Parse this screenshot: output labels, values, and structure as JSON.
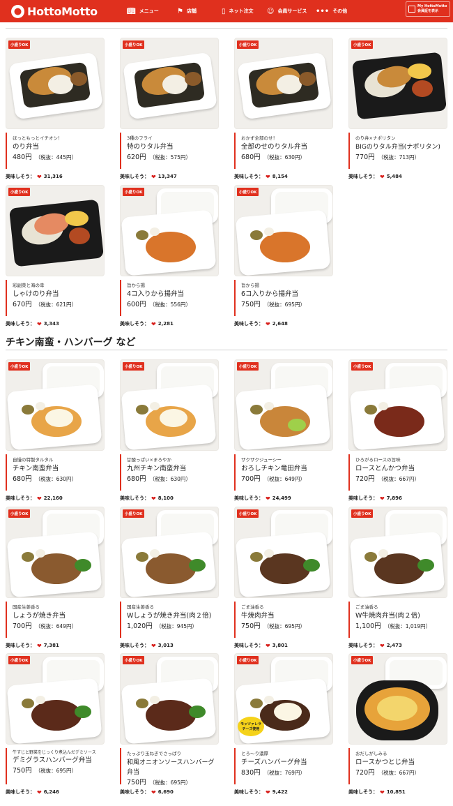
{
  "header": {
    "logo_text": "HottoMotto",
    "nav": [
      {
        "label": "メニュー",
        "icon": "book-icon"
      },
      {
        "label": "店舗",
        "icon": "map-pin-icon"
      },
      {
        "label": "ネット注文",
        "icon": "phone-icon"
      },
      {
        "label": "会員サービス",
        "icon": "people-icon"
      },
      {
        "label": "その他",
        "icon": "dots-icon"
      }
    ],
    "member_line1": "My HottoMotto",
    "member_line2": "会員証を表示"
  },
  "badge_label": "小盛りOK",
  "likes_label": "美味しそう：",
  "section_title": "チキン南蛮・ハンバーグ など",
  "colors": {
    "brand": "#e0301e",
    "heart": "#d8201c"
  },
  "items": [
    {
      "sub": "ほっともっとイチオシ！",
      "name": "のり弁当",
      "price": "480円",
      "tax": "（税抜：445円）",
      "likes": "31,316",
      "style": "nori"
    },
    {
      "sub": "3種のフライ",
      "name": "特のりタル弁当",
      "price": "620円",
      "tax": "（税抜：575円）",
      "likes": "13,347",
      "style": "nori"
    },
    {
      "sub": "おかず全部のせ！",
      "name": "全部のせのりタル弁当",
      "price": "680円",
      "tax": "（税抜：630円）",
      "likes": "8,154",
      "style": "nori"
    },
    {
      "sub": "のり弁×ナポリタン",
      "name": "BIGのりタル弁当(ナポリタン)",
      "price": "770円",
      "tax": "（税抜：713円）",
      "likes": "5,484",
      "style": "dark"
    },
    {
      "sub": "彩副菜と海の幸",
      "name": "しゃけのり弁当",
      "price": "670円",
      "tax": "（税抜：621円）",
      "likes": "3,343",
      "style": "dark"
    },
    {
      "sub": "旨から揚",
      "name": "4コ入りから揚弁当",
      "price": "600円",
      "tax": "（税抜：556円）",
      "likes": "2,281",
      "style": "karaage"
    },
    {
      "sub": "旨から揚",
      "name": "6コ入りから揚弁当",
      "price": "750円",
      "tax": "（税抜：695円）",
      "likes": "2,648",
      "style": "karaage"
    },
    {
      "sub": "自慢の特製タルタル",
      "name": "チキン南蛮弁当",
      "price": "680円",
      "tax": "（税抜：630円）",
      "likes": "22,160",
      "style": "nanban"
    },
    {
      "sub": "甘酸っぱい×まろやか",
      "name": "九州チキン南蛮弁当",
      "price": "680円",
      "tax": "（税抜：630円）",
      "likes": "8,100",
      "style": "nanban"
    },
    {
      "sub": "ザクザクジューシー",
      "name": "おろしチキン竜田弁当",
      "price": "700円",
      "tax": "（税抜：649円）",
      "likes": "24,499",
      "style": "tatsuta"
    },
    {
      "sub": "ひろがるロースの旨味",
      "name": "ロースとんかつ弁当",
      "price": "720円",
      "tax": "（税抜：667円）",
      "likes": "7,896",
      "style": "tonkatsu"
    },
    {
      "sub": "国産生姜香る",
      "name": "しょうが焼き弁当",
      "price": "700円",
      "tax": "（税抜：649円）",
      "likes": "7,381",
      "style": "shoga"
    },
    {
      "sub": "国産生姜香る",
      "name": "Wしょうが焼き弁当(肉２倍)",
      "price": "1,020円",
      "tax": "（税抜：945円）",
      "likes": "3,013",
      "style": "shoga"
    },
    {
      "sub": "ごま油香る",
      "name": "牛焼肉弁当",
      "price": "750円",
      "tax": "（税抜：695円）",
      "likes": "3,801",
      "style": "yakiniku"
    },
    {
      "sub": "ごま油香る",
      "name": "W牛焼肉弁当(肉２倍)",
      "price": "1,100円",
      "tax": "（税抜：1,019円）",
      "likes": "2,473",
      "style": "yakiniku"
    },
    {
      "sub": "牛すじと野菜をじっくり煮込んだデミソース",
      "name": "デミグラスハンバーグ弁当",
      "price": "750円",
      "tax": "（税抜：695円）",
      "likes": "6,246",
      "style": "hamburg"
    },
    {
      "sub": "たっぷり玉ねぎでさっぱり",
      "name": "和風オニオンソースハンバーグ弁当",
      "price": "750円",
      "tax": "（税抜：695円）",
      "likes": "6,690",
      "style": "hamburg"
    },
    {
      "sub": "とろ〜り濃厚",
      "name": "チーズハンバーグ弁当",
      "price": "830円",
      "tax": "（税抜：769円）",
      "likes": "9,422",
      "style": "cheese"
    },
    {
      "sub": "おだしがしみる",
      "name": "ロースかつとじ弁当",
      "price": "720円",
      "tax": "（税抜：667円）",
      "likes": "10,851",
      "style": "katsudon"
    }
  ],
  "cheese_sticker_line1": "モッツァレラ",
  "cheese_sticker_line2": "チーズ使用"
}
